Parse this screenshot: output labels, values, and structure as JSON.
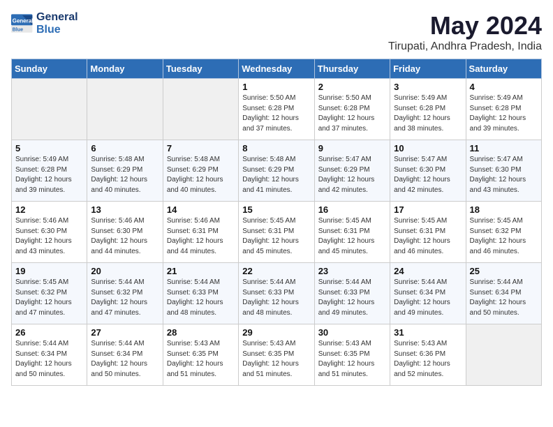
{
  "logo": {
    "line1": "General",
    "line2": "Blue"
  },
  "title": "May 2024",
  "subtitle": "Tirupati, Andhra Pradesh, India",
  "days_of_week": [
    "Sunday",
    "Monday",
    "Tuesday",
    "Wednesday",
    "Thursday",
    "Friday",
    "Saturday"
  ],
  "weeks": [
    [
      {
        "num": "",
        "info": ""
      },
      {
        "num": "",
        "info": ""
      },
      {
        "num": "",
        "info": ""
      },
      {
        "num": "1",
        "info": "Sunrise: 5:50 AM\nSunset: 6:28 PM\nDaylight: 12 hours\nand 37 minutes."
      },
      {
        "num": "2",
        "info": "Sunrise: 5:50 AM\nSunset: 6:28 PM\nDaylight: 12 hours\nand 37 minutes."
      },
      {
        "num": "3",
        "info": "Sunrise: 5:49 AM\nSunset: 6:28 PM\nDaylight: 12 hours\nand 38 minutes."
      },
      {
        "num": "4",
        "info": "Sunrise: 5:49 AM\nSunset: 6:28 PM\nDaylight: 12 hours\nand 39 minutes."
      }
    ],
    [
      {
        "num": "5",
        "info": "Sunrise: 5:49 AM\nSunset: 6:28 PM\nDaylight: 12 hours\nand 39 minutes."
      },
      {
        "num": "6",
        "info": "Sunrise: 5:48 AM\nSunset: 6:29 PM\nDaylight: 12 hours\nand 40 minutes."
      },
      {
        "num": "7",
        "info": "Sunrise: 5:48 AM\nSunset: 6:29 PM\nDaylight: 12 hours\nand 40 minutes."
      },
      {
        "num": "8",
        "info": "Sunrise: 5:48 AM\nSunset: 6:29 PM\nDaylight: 12 hours\nand 41 minutes."
      },
      {
        "num": "9",
        "info": "Sunrise: 5:47 AM\nSunset: 6:29 PM\nDaylight: 12 hours\nand 42 minutes."
      },
      {
        "num": "10",
        "info": "Sunrise: 5:47 AM\nSunset: 6:30 PM\nDaylight: 12 hours\nand 42 minutes."
      },
      {
        "num": "11",
        "info": "Sunrise: 5:47 AM\nSunset: 6:30 PM\nDaylight: 12 hours\nand 43 minutes."
      }
    ],
    [
      {
        "num": "12",
        "info": "Sunrise: 5:46 AM\nSunset: 6:30 PM\nDaylight: 12 hours\nand 43 minutes."
      },
      {
        "num": "13",
        "info": "Sunrise: 5:46 AM\nSunset: 6:30 PM\nDaylight: 12 hours\nand 44 minutes."
      },
      {
        "num": "14",
        "info": "Sunrise: 5:46 AM\nSunset: 6:31 PM\nDaylight: 12 hours\nand 44 minutes."
      },
      {
        "num": "15",
        "info": "Sunrise: 5:45 AM\nSunset: 6:31 PM\nDaylight: 12 hours\nand 45 minutes."
      },
      {
        "num": "16",
        "info": "Sunrise: 5:45 AM\nSunset: 6:31 PM\nDaylight: 12 hours\nand 45 minutes."
      },
      {
        "num": "17",
        "info": "Sunrise: 5:45 AM\nSunset: 6:31 PM\nDaylight: 12 hours\nand 46 minutes."
      },
      {
        "num": "18",
        "info": "Sunrise: 5:45 AM\nSunset: 6:32 PM\nDaylight: 12 hours\nand 46 minutes."
      }
    ],
    [
      {
        "num": "19",
        "info": "Sunrise: 5:45 AM\nSunset: 6:32 PM\nDaylight: 12 hours\nand 47 minutes."
      },
      {
        "num": "20",
        "info": "Sunrise: 5:44 AM\nSunset: 6:32 PM\nDaylight: 12 hours\nand 47 minutes."
      },
      {
        "num": "21",
        "info": "Sunrise: 5:44 AM\nSunset: 6:33 PM\nDaylight: 12 hours\nand 48 minutes."
      },
      {
        "num": "22",
        "info": "Sunrise: 5:44 AM\nSunset: 6:33 PM\nDaylight: 12 hours\nand 48 minutes."
      },
      {
        "num": "23",
        "info": "Sunrise: 5:44 AM\nSunset: 6:33 PM\nDaylight: 12 hours\nand 49 minutes."
      },
      {
        "num": "24",
        "info": "Sunrise: 5:44 AM\nSunset: 6:34 PM\nDaylight: 12 hours\nand 49 minutes."
      },
      {
        "num": "25",
        "info": "Sunrise: 5:44 AM\nSunset: 6:34 PM\nDaylight: 12 hours\nand 50 minutes."
      }
    ],
    [
      {
        "num": "26",
        "info": "Sunrise: 5:44 AM\nSunset: 6:34 PM\nDaylight: 12 hours\nand 50 minutes."
      },
      {
        "num": "27",
        "info": "Sunrise: 5:44 AM\nSunset: 6:34 PM\nDaylight: 12 hours\nand 50 minutes."
      },
      {
        "num": "28",
        "info": "Sunrise: 5:43 AM\nSunset: 6:35 PM\nDaylight: 12 hours\nand 51 minutes."
      },
      {
        "num": "29",
        "info": "Sunrise: 5:43 AM\nSunset: 6:35 PM\nDaylight: 12 hours\nand 51 minutes."
      },
      {
        "num": "30",
        "info": "Sunrise: 5:43 AM\nSunset: 6:35 PM\nDaylight: 12 hours\nand 51 minutes."
      },
      {
        "num": "31",
        "info": "Sunrise: 5:43 AM\nSunset: 6:36 PM\nDaylight: 12 hours\nand 52 minutes."
      },
      {
        "num": "",
        "info": ""
      }
    ]
  ]
}
